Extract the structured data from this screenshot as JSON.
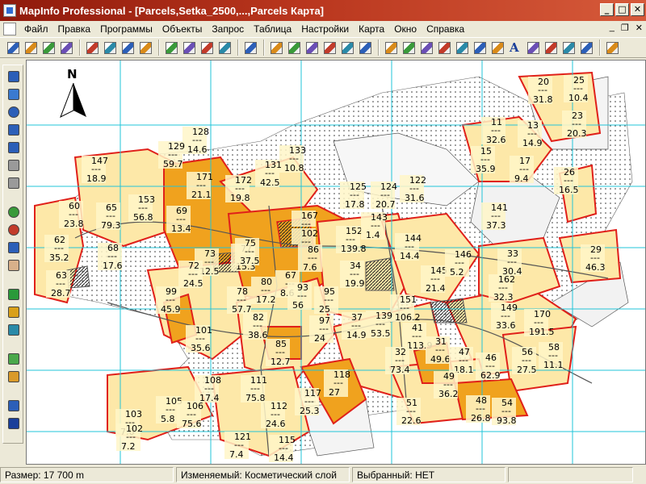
{
  "window": {
    "title": "MapInfo Professional - [Parcels,Setka_2500,...,Parcels Карта]",
    "controls": {
      "minimize": "_",
      "maximize": "□",
      "close": "✕"
    },
    "mdi_controls": {
      "minimize": "_",
      "restore": "❐",
      "close": "✕"
    }
  },
  "menu": [
    "Файл",
    "Правка",
    "Программы",
    "Объекты",
    "Запрос",
    "Таблица",
    "Настройки",
    "Карта",
    "Окно",
    "Справка"
  ],
  "toolbar": {
    "buttons": [
      "new-icon",
      "open-icon",
      "open-workspace-icon",
      "save-icon",
      "save-as-icon",
      "open-table-icon",
      "print-preview-icon",
      "print-icon",
      "cut-icon",
      "copy-icon",
      "paste-icon",
      "undo-icon",
      "new-browser-icon",
      "new-mapper-icon",
      "new-graph-icon",
      "new-layout-icon",
      "new-redistrict-icon",
      "help-icon",
      "symbol-icon",
      "line-icon",
      "polyline-icon",
      "arc-icon",
      "polygon-icon",
      "ellipse-icon",
      "rectangle-icon",
      "rounded-rect-icon",
      "text-icon",
      "frame-icon",
      "reshape-icon",
      "add-node-icon",
      "arrow-icon",
      "legend-icon"
    ]
  },
  "tools": [
    "select-icon",
    "marquee-select-icon",
    "radius-select-icon",
    "boundary-select-icon",
    "polygon-select-icon",
    "unselect-icon",
    "invert-select-icon",
    "zoom-in-icon",
    "zoom-out-icon",
    "change-view-icon",
    "grabber-icon",
    "info-icon",
    "label-icon",
    "hotlink-icon",
    "layer-control-icon",
    "ruler-icon",
    "legend-icon",
    "statistics-icon"
  ],
  "map": {
    "north_label": "N",
    "colors": {
      "grid": "#22c4d8",
      "parcel_border": "#e0201a",
      "fill_light": "#fde8a8",
      "fill_orange": "#f0a21e",
      "road": "#555555"
    },
    "labels": [
      {
        "id": "20",
        "area": "31.8"
      },
      {
        "id": "25",
        "area": "10.4"
      },
      {
        "id": "23",
        "area": "20.3"
      },
      {
        "id": "11",
        "area": "32.6"
      },
      {
        "id": "13",
        "area": "14.9"
      },
      {
        "id": "15",
        "area": "35.9"
      },
      {
        "id": "17",
        "area": "9.4"
      },
      {
        "id": "26",
        "area": "16.5"
      },
      {
        "id": "29",
        "area": "46.3"
      },
      {
        "id": "128",
        "area": "14.6"
      },
      {
        "id": "129",
        "area": "59.7"
      },
      {
        "id": "147",
        "area": "18.9"
      },
      {
        "id": "133",
        "area": "10.8"
      },
      {
        "id": "131",
        "area": "42.5"
      },
      {
        "id": "171",
        "area": "21.1"
      },
      {
        "id": "172",
        "area": "19.8"
      },
      {
        "id": "153",
        "area": "56.8"
      },
      {
        "id": "60",
        "area": "23.8"
      },
      {
        "id": "65",
        "area": "79.3"
      },
      {
        "id": "69",
        "area": "13.4"
      },
      {
        "id": "125",
        "area": "17.8"
      },
      {
        "id": "124",
        "area": "20.7"
      },
      {
        "id": "122",
        "area": "31.6"
      },
      {
        "id": "141",
        "area": "37.3"
      },
      {
        "id": "167",
        "area": ""
      },
      {
        "id": "102",
        "area": ""
      },
      {
        "id": "152",
        "area": "139.8"
      },
      {
        "id": "143",
        "area": "1.4"
      },
      {
        "id": "144",
        "area": "14.4"
      },
      {
        "id": "62",
        "area": "35.2"
      },
      {
        "id": "68",
        "area": "17.6"
      },
      {
        "id": "73",
        "area": "12.5"
      },
      {
        "id": "77",
        "area": "15.3"
      },
      {
        "id": "75",
        "area": "37.5"
      },
      {
        "id": "67",
        "area": "8.6"
      },
      {
        "id": "86",
        "area": "7.6"
      },
      {
        "id": "34",
        "area": "19.9"
      },
      {
        "id": "145",
        "area": "21.4"
      },
      {
        "id": "146",
        "area": "5.2"
      },
      {
        "id": "33",
        "area": "30.4"
      },
      {
        "id": "162",
        "area": "32.3"
      },
      {
        "id": "149",
        "area": "33.6"
      },
      {
        "id": "63",
        "area": "28.7"
      },
      {
        "id": "72",
        "area": "24.5"
      },
      {
        "id": "78",
        "area": "57.7"
      },
      {
        "id": "80",
        "area": "17.2"
      },
      {
        "id": "93",
        "area": "56"
      },
      {
        "id": "95",
        "area": "25"
      },
      {
        "id": "151",
        "area": "106.2"
      },
      {
        "id": "99",
        "area": "45.9"
      },
      {
        "id": "82",
        "area": "38.6"
      },
      {
        "id": "97",
        "area": "24"
      },
      {
        "id": "37",
        "area": "14.9"
      },
      {
        "id": "139",
        "area": "53.5"
      },
      {
        "id": "41",
        "area": "113.9"
      },
      {
        "id": "31",
        "area": "49.6"
      },
      {
        "id": "170",
        "area": "191.5"
      },
      {
        "id": "101",
        "area": "35.6"
      },
      {
        "id": "85",
        "area": "12.7"
      },
      {
        "id": "32",
        "area": "73.4"
      },
      {
        "id": "47",
        "area": "18.1"
      },
      {
        "id": "46",
        "area": "62.9"
      },
      {
        "id": "56",
        "area": "27.5"
      },
      {
        "id": "58",
        "area": "11.1"
      },
      {
        "id": "118",
        "area": "27"
      },
      {
        "id": "49",
        "area": "36.2"
      },
      {
        "id": "48",
        "area": "26.8"
      },
      {
        "id": "108",
        "area": "17.4"
      },
      {
        "id": "111",
        "area": "75.8"
      },
      {
        "id": "117",
        "area": "25.3"
      },
      {
        "id": "105",
        "area": "5.8"
      },
      {
        "id": "106",
        "area": "75.6"
      },
      {
        "id": "112",
        "area": "24.6"
      },
      {
        "id": "51",
        "area": "22.6"
      },
      {
        "id": "54",
        "area": "93.8"
      },
      {
        "id": "103",
        "area": "7.6"
      },
      {
        "id": "102",
        "area": "7.2"
      },
      {
        "id": "121",
        "area": "7.4"
      },
      {
        "id": "115",
        "area": "14.4"
      }
    ]
  },
  "status": {
    "size": "Размер: 17 700 m",
    "editable": "Изменяемый: Косметический слой",
    "selected": "Выбранный: НЕТ"
  }
}
